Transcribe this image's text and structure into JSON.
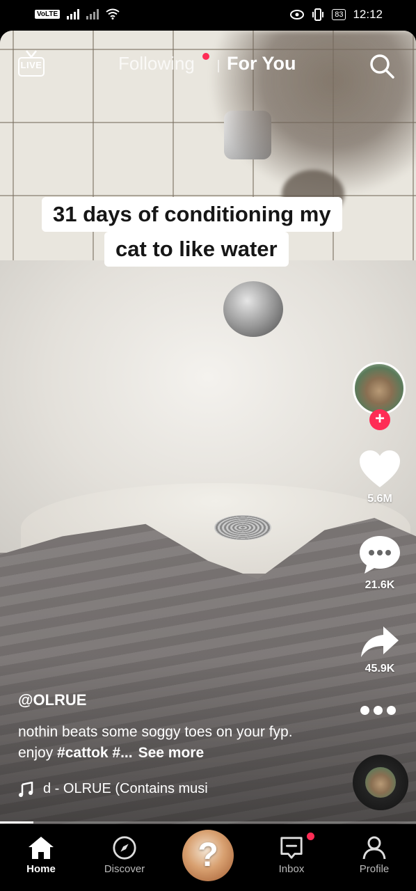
{
  "status_bar": {
    "carrier_badge": "VoLTE",
    "battery": "83",
    "time": "12:12"
  },
  "top_nav": {
    "live_label": "LIVE",
    "following_label": "Following",
    "for_you_label": "For You"
  },
  "video": {
    "caption_line1": "31 days of conditioning my",
    "caption_line2": "cat to like water"
  },
  "actions": {
    "likes": "5.6M",
    "comments": "21.6K",
    "shares": "45.9K"
  },
  "post": {
    "username": "@OLRUE",
    "description_text": "nothin beats some soggy toes on your fyp. enjoy ",
    "hashtag": "#cattok",
    "hashtag_trunc": " #...",
    "see_more": "See more",
    "music": "d - OLRUE (Contains musi",
    "progress_fraction": 0.08
  },
  "tab_bar": {
    "home": "Home",
    "discover": "Discover",
    "inbox": "Inbox",
    "profile": "Profile",
    "create_glyph": "?"
  },
  "colors": {
    "accent": "#fe2c55",
    "background": "#000000"
  }
}
